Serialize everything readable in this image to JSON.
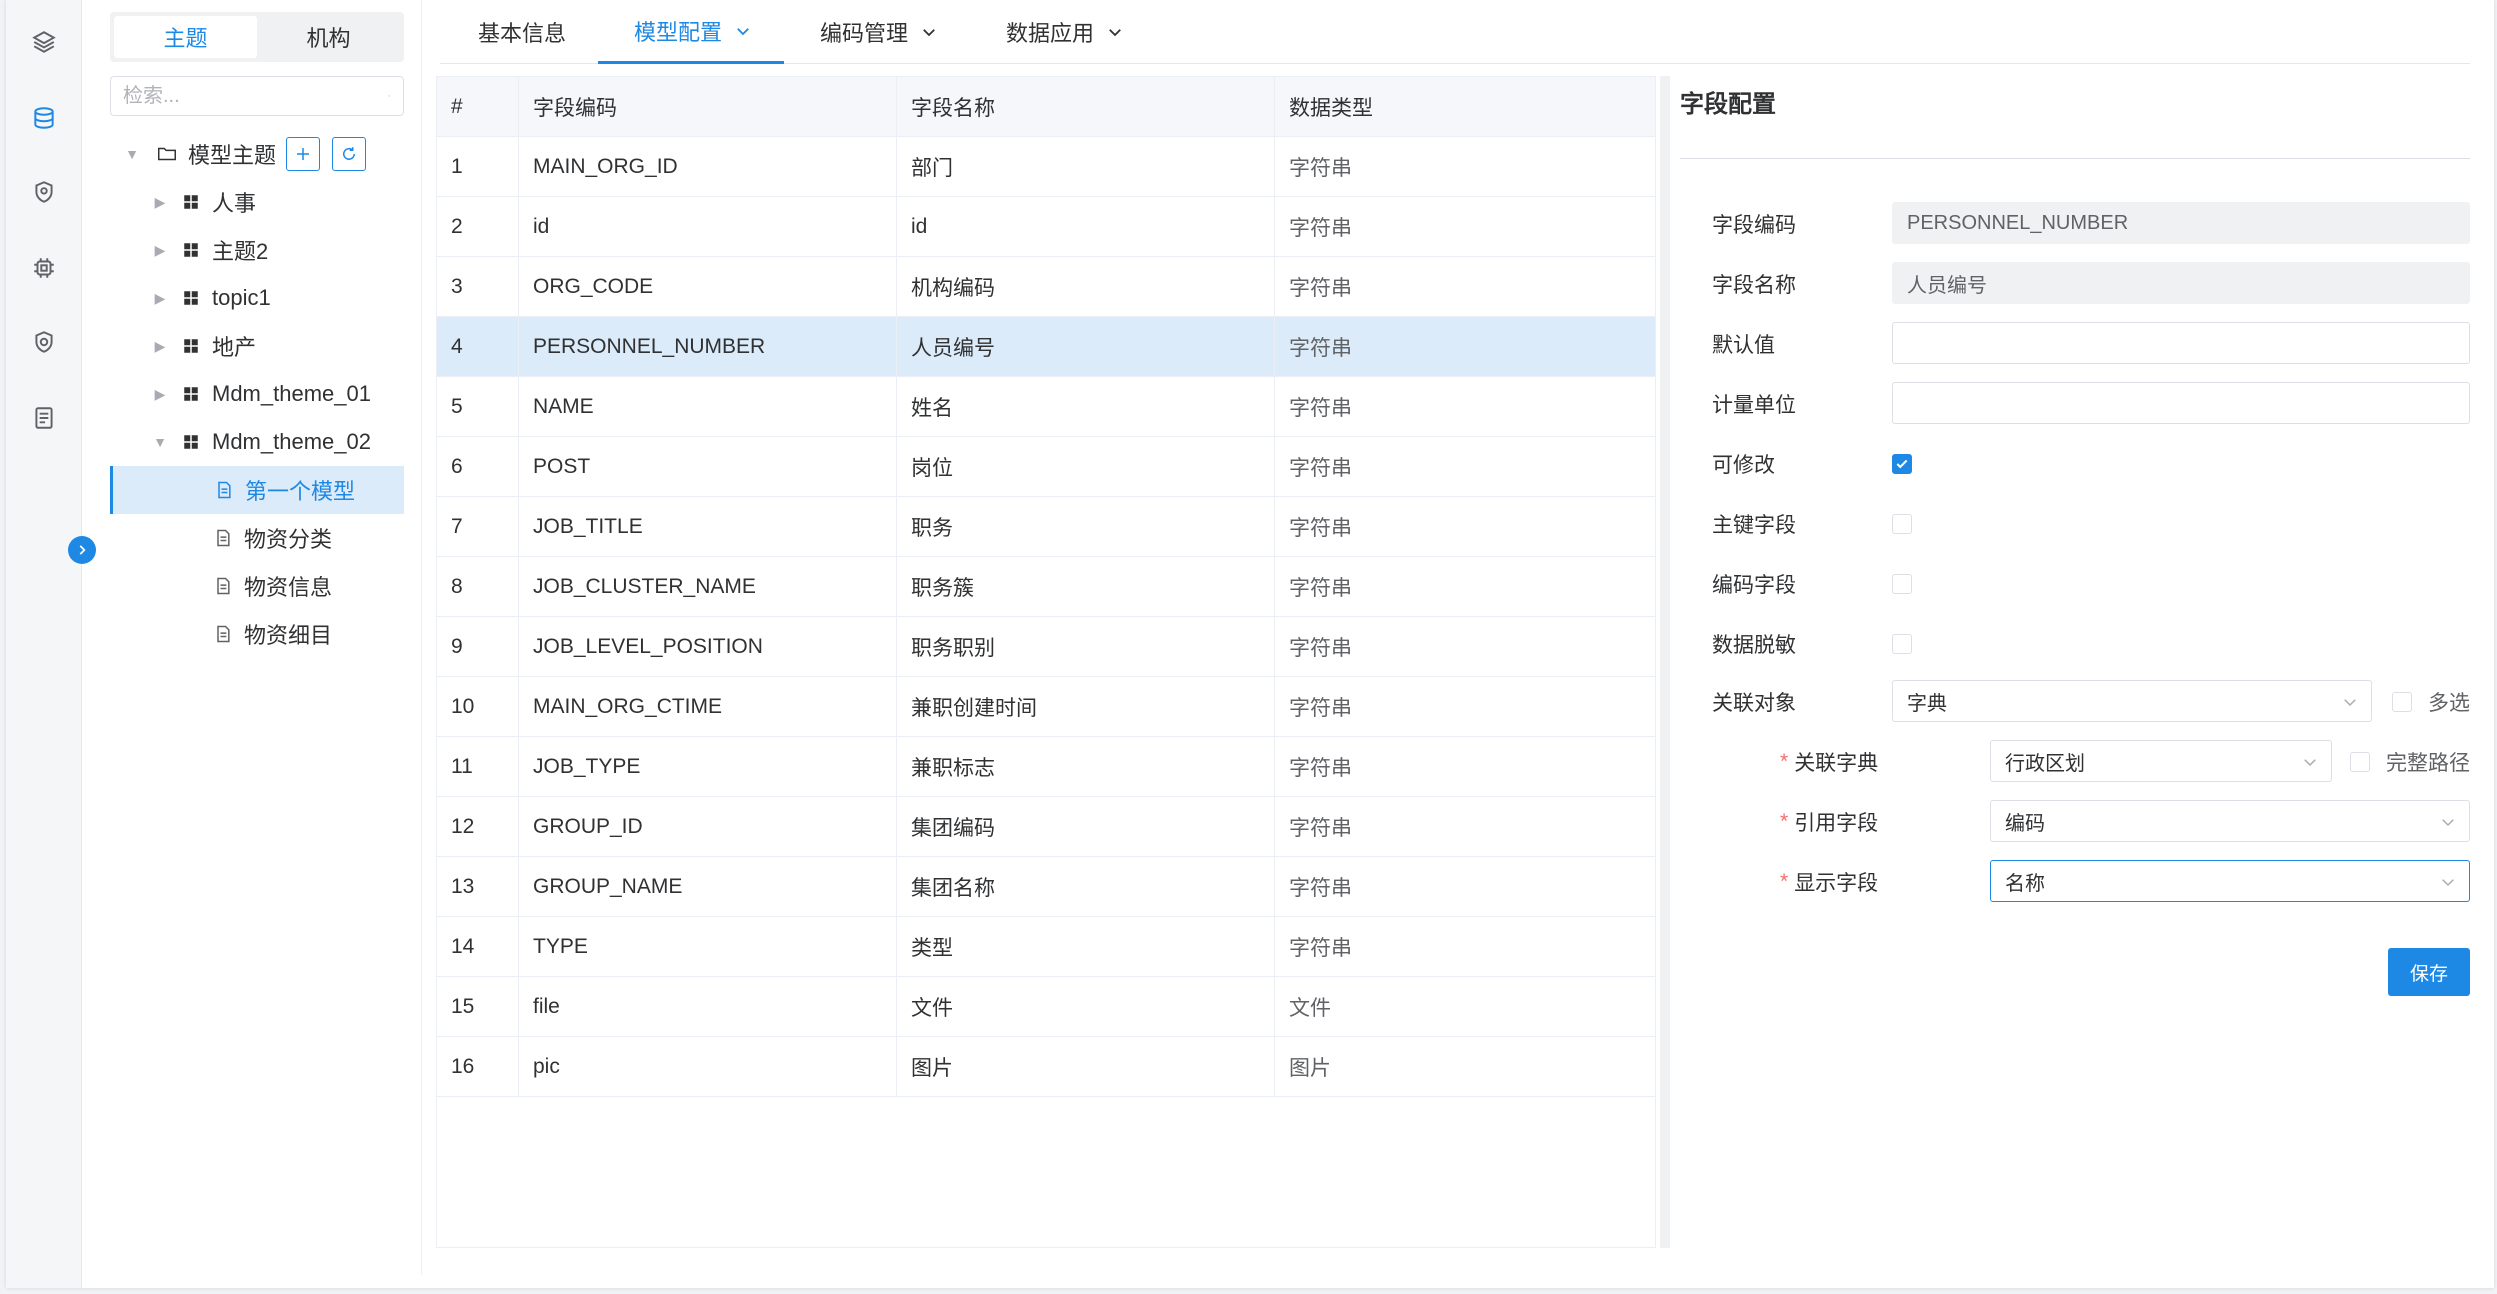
{
  "colors": {
    "accent": "#1e88e5",
    "selected_bg": "#dcebf9",
    "required": "#f56c6c"
  },
  "rail": {
    "icons": [
      "layers-icon",
      "database-icon",
      "shield-location-icon",
      "chip-icon",
      "shield-check-icon",
      "document-list-icon"
    ]
  },
  "tree_panel": {
    "segments": [
      "主题",
      "机构"
    ],
    "search_placeholder": "检索...",
    "root": {
      "label": "模型主题"
    },
    "nodes": [
      {
        "label": "人事"
      },
      {
        "label": "主题2"
      },
      {
        "label": "topic1"
      },
      {
        "label": "地产"
      },
      {
        "label": "Mdm_theme_01"
      },
      {
        "label": "Mdm_theme_02"
      }
    ],
    "models": [
      {
        "label": "第一个模型"
      },
      {
        "label": "物资分类"
      },
      {
        "label": "物资信息"
      },
      {
        "label": "物资细目"
      }
    ]
  },
  "tabs": [
    {
      "label": "基本信息"
    },
    {
      "label": "模型配置"
    },
    {
      "label": "编码管理"
    },
    {
      "label": "数据应用"
    }
  ],
  "table": {
    "headers": [
      "#",
      "字段编码",
      "字段名称",
      "数据类型"
    ],
    "rows": [
      [
        "1",
        "MAIN_ORG_ID",
        "部门",
        "字符串"
      ],
      [
        "2",
        "id",
        "id",
        "字符串"
      ],
      [
        "3",
        "ORG_CODE",
        "机构编码",
        "字符串"
      ],
      [
        "4",
        "PERSONNEL_NUMBER",
        "人员编号",
        "字符串"
      ],
      [
        "5",
        "NAME",
        "姓名",
        "字符串"
      ],
      [
        "6",
        "POST",
        "岗位",
        "字符串"
      ],
      [
        "7",
        "JOB_TITLE",
        "职务",
        "字符串"
      ],
      [
        "8",
        "JOB_CLUSTER_NAME",
        "职务簇",
        "字符串"
      ],
      [
        "9",
        "JOB_LEVEL_POSITION",
        "职务职别",
        "字符串"
      ],
      [
        "10",
        "MAIN_ORG_CTIME",
        "兼职创建时间",
        "字符串"
      ],
      [
        "11",
        "JOB_TYPE",
        "兼职标志",
        "字符串"
      ],
      [
        "12",
        "GROUP_ID",
        "集团编码",
        "字符串"
      ],
      [
        "13",
        "GROUP_NAME",
        "集团名称",
        "字符串"
      ],
      [
        "14",
        "TYPE",
        "类型",
        "字符串"
      ],
      [
        "15",
        "file",
        "文件",
        "文件"
      ],
      [
        "16",
        "pic",
        "图片",
        "图片"
      ]
    ]
  },
  "form": {
    "title": "字段配置",
    "field_code_label": "字段编码",
    "field_code_value": "PERSONNEL_NUMBER",
    "field_name_label": "字段名称",
    "field_name_value": "人员编号",
    "default_label": "默认值",
    "default_value": "",
    "unit_label": "计量单位",
    "unit_value": "",
    "editable_label": "可修改",
    "pk_label": "主键字段",
    "code_field_label": "编码字段",
    "mask_label": "数据脱敏",
    "relation_label": "关联对象",
    "relation_value": "字典",
    "multi_label": "多选",
    "dict_label": "关联字典",
    "dict_value": "行政区划",
    "fullpath_label": "完整路径",
    "ref_label": "引用字段",
    "ref_value": "编码",
    "display_label": "显示字段",
    "display_value": "名称",
    "required_mark": "*",
    "save_label": "保存"
  }
}
